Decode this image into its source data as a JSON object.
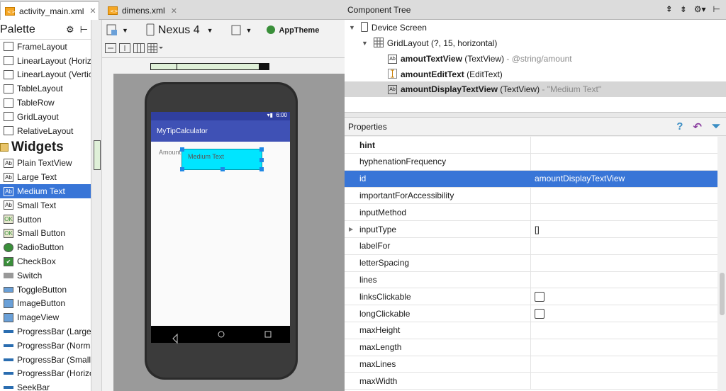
{
  "tabs": [
    {
      "label": "activity_main.xml",
      "active": true
    },
    {
      "label": "dimens.xml",
      "active": false
    }
  ],
  "palette": {
    "title": "Palette",
    "layouts": [
      "FrameLayout",
      "LinearLayout (Horizo",
      "LinearLayout (Vertic",
      "TableLayout",
      "TableRow",
      "GridLayout",
      "RelativeLayout"
    ],
    "widgets_title": "Widgets",
    "widgets": [
      "Plain TextView",
      "Large Text",
      "Medium Text",
      "Small Text",
      "Button",
      "Small Button",
      "RadioButton",
      "CheckBox",
      "Switch",
      "ToggleButton",
      "ImageButton",
      "ImageView",
      "ProgressBar (Large)",
      "ProgressBar (Norma",
      "ProgressBar (Small)",
      "ProgressBar (Horizo",
      "SeekBar"
    ],
    "selected_widget": "Medium Text"
  },
  "toolbar": {
    "device": "Nexus 4",
    "theme": "AppTheme"
  },
  "phone": {
    "status_time": "6:00",
    "app_title": "MyTipCalculator",
    "amount_label": "Amount",
    "medium_text": "Medium Text"
  },
  "component_tree": {
    "title": "Component Tree",
    "root": "Device Screen",
    "grid": "GridLayout (?, 15, horizontal)",
    "items": [
      {
        "name": "amoutTextView",
        "type": "(TextView)",
        "extra": "- @string/amount"
      },
      {
        "name": "amountEditText",
        "type": "(EditText)",
        "extra": ""
      },
      {
        "name": "amountDisplayTextView",
        "type": "(TextView)",
        "extra": "- \"Medium Text\""
      }
    ]
  },
  "properties": {
    "title": "Properties",
    "rows": [
      {
        "name": "hint",
        "value": "",
        "bold": true
      },
      {
        "name": "hyphenationFrequency",
        "value": ""
      },
      {
        "name": "id",
        "value": "amountDisplayTextView",
        "selected": true
      },
      {
        "name": "importantForAccessibility",
        "value": ""
      },
      {
        "name": "inputMethod",
        "value": ""
      },
      {
        "name": "inputType",
        "value": "[]",
        "expandable": true
      },
      {
        "name": "labelFor",
        "value": ""
      },
      {
        "name": "letterSpacing",
        "value": ""
      },
      {
        "name": "lines",
        "value": ""
      },
      {
        "name": "linksClickable",
        "value": "",
        "checkbox": true
      },
      {
        "name": "longClickable",
        "value": "",
        "checkbox": true
      },
      {
        "name": "maxHeight",
        "value": ""
      },
      {
        "name": "maxLength",
        "value": ""
      },
      {
        "name": "maxLines",
        "value": ""
      },
      {
        "name": "maxWidth",
        "value": ""
      }
    ]
  }
}
